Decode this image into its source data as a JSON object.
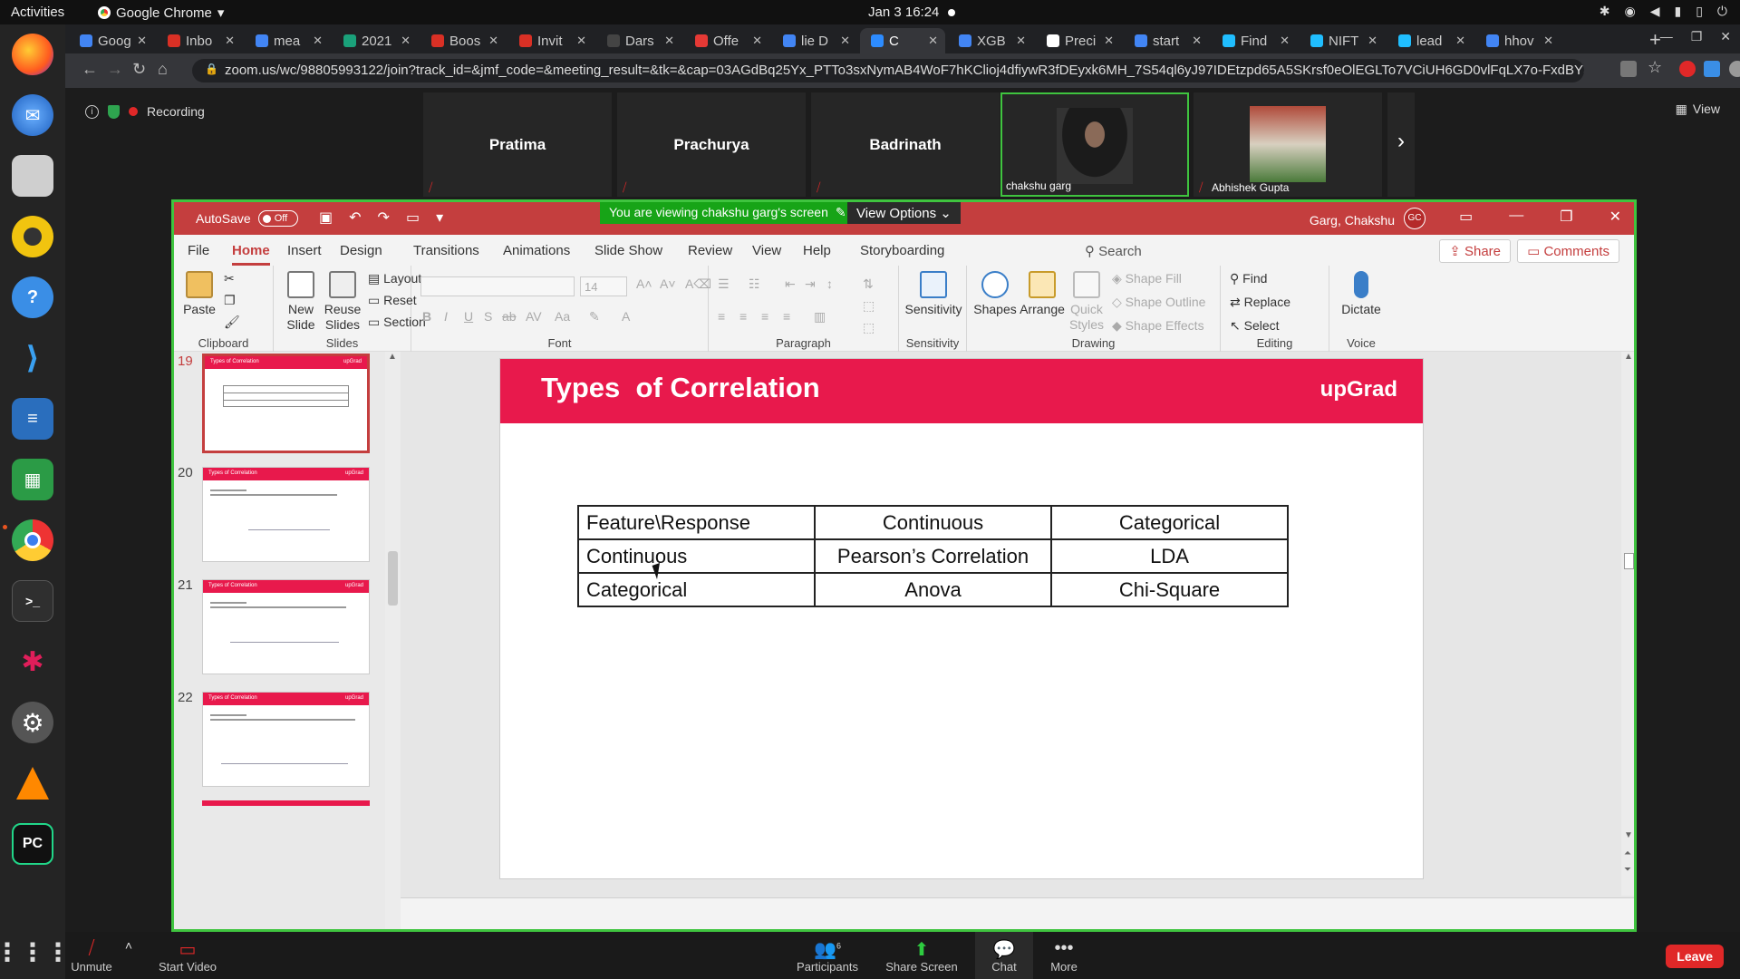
{
  "topbar": {
    "activities": "Activities",
    "app_name": "Google Chrome",
    "clock": "Jan 3  16:24"
  },
  "dock": {
    "apps": [
      "firefox-icon",
      "thunderbird-icon",
      "files-icon",
      "rhythmbox-icon",
      "help-icon",
      "vscode-icon",
      "writer-icon",
      "calc-icon",
      "chrome-icon",
      "terminal-icon",
      "slack-icon",
      "settings-icon",
      "vlc-icon",
      "pycharm-icon",
      "app-grid-icon"
    ]
  },
  "browser": {
    "tabs": [
      {
        "label": "Goog",
        "color": "#4285f4"
      },
      {
        "label": "Inbo",
        "color": "#d93025"
      },
      {
        "label": "mea",
        "color": "#4285f4"
      },
      {
        "label": "2021",
        "color": "#1aa17a"
      },
      {
        "label": "Boos",
        "color": "#d93025"
      },
      {
        "label": "Invit",
        "color": "#d93025"
      },
      {
        "label": "Dars",
        "color": "#444444"
      },
      {
        "label": "Offe",
        "color": "#e53935"
      },
      {
        "label": "lie D",
        "color": "#4285f4"
      },
      {
        "label": "C",
        "color": "#2d8cff"
      },
      {
        "label": "XGB",
        "color": "#4285f4"
      },
      {
        "label": "Preci",
        "color": "#ffffff"
      },
      {
        "label": "start",
        "color": "#4285f4"
      },
      {
        "label": "Find",
        "color": "#20beff"
      },
      {
        "label": "NIFT",
        "color": "#20beff"
      },
      {
        "label": "lead",
        "color": "#20beff"
      },
      {
        "label": "hhov",
        "color": "#4285f4"
      }
    ],
    "active_tab_index": 9,
    "url": "zoom.us/wc/98805993122/join?track_id=&jmf_code=&meeting_result=&tk=&cap=03AGdBq25Yx_PTTo3sxNymAB4WoF7hKClioj4dfiywR3fDEyxk6MH_7S54ql6yJ97IDEtzpd65A5SKrsf0eOlEGLTo7VCiUH6GD0vlFqLX7o-FxdBYS12jNc..."
  },
  "zoom": {
    "recording_label": "Recording",
    "view_label": "View",
    "participants": [
      {
        "name": "Pratima"
      },
      {
        "name": "Prachurya"
      },
      {
        "name": "Badrinath"
      },
      {
        "name": "chakshu garg"
      },
      {
        "name": "Abhishek Gupta"
      }
    ],
    "share_banner": "You are viewing chakshu garg's screen",
    "view_options": "View Options",
    "bottom": {
      "unmute": "Unmute",
      "start_video": "Start Video",
      "participants": "Participants",
      "participants_count": "6",
      "share_screen": "Share Screen",
      "chat": "Chat",
      "more": "More",
      "leave": "Leave"
    }
  },
  "ppt": {
    "autosave_label": "AutoSave",
    "autosave_state": "Off",
    "user_name": "Garg, Chakshu",
    "user_initials": "GC",
    "tabs": [
      "File",
      "Home",
      "Insert",
      "Design",
      "Transitions",
      "Animations",
      "Slide Show",
      "Review",
      "View",
      "Help",
      "Storyboarding"
    ],
    "search_label": "Search",
    "share_label": "Share",
    "comments_label": "Comments",
    "groups": {
      "clipboard": "Clipboard",
      "slides": "Slides",
      "font": "Font",
      "paragraph": "Paragraph",
      "sensitivity": "Sensitivity",
      "drawing": "Drawing",
      "editing": "Editing",
      "voice": "Voice"
    },
    "buttons": {
      "paste": "Paste",
      "new_slide": "New Slide",
      "reuse_slides": "Reuse Slides",
      "layout": "Layout",
      "reset": "Reset",
      "section": "Section",
      "font_size": "14",
      "sensitivity": "Sensitivity",
      "shapes": "Shapes",
      "arrange": "Arrange",
      "quick_styles": "Quick Styles",
      "shape_fill": "Shape Fill",
      "shape_outline": "Shape Outline",
      "shape_effects": "Shape Effects",
      "find": "Find",
      "replace": "Replace",
      "select": "Select",
      "dictate": "Dictate"
    },
    "thumbnails": [
      {
        "num": "19",
        "title": "Types of Correlation",
        "brand": "upGrad"
      },
      {
        "num": "20",
        "title": "Types of Correlation",
        "brand": "upGrad"
      },
      {
        "num": "21",
        "title": "Types of Correlation",
        "brand": "upGrad"
      },
      {
        "num": "22",
        "title": "Types of Correlation",
        "brand": "upGrad"
      }
    ],
    "slide": {
      "title": "Types  of Correlation",
      "brand": "upGrad",
      "table": [
        [
          "Feature\\Response",
          "Continuous",
          "Categorical"
        ],
        [
          "Continuous",
          "Pearson’s Correlation",
          "LDA"
        ],
        [
          "Categorical",
          "Anova",
          "Chi-Square"
        ]
      ]
    }
  }
}
